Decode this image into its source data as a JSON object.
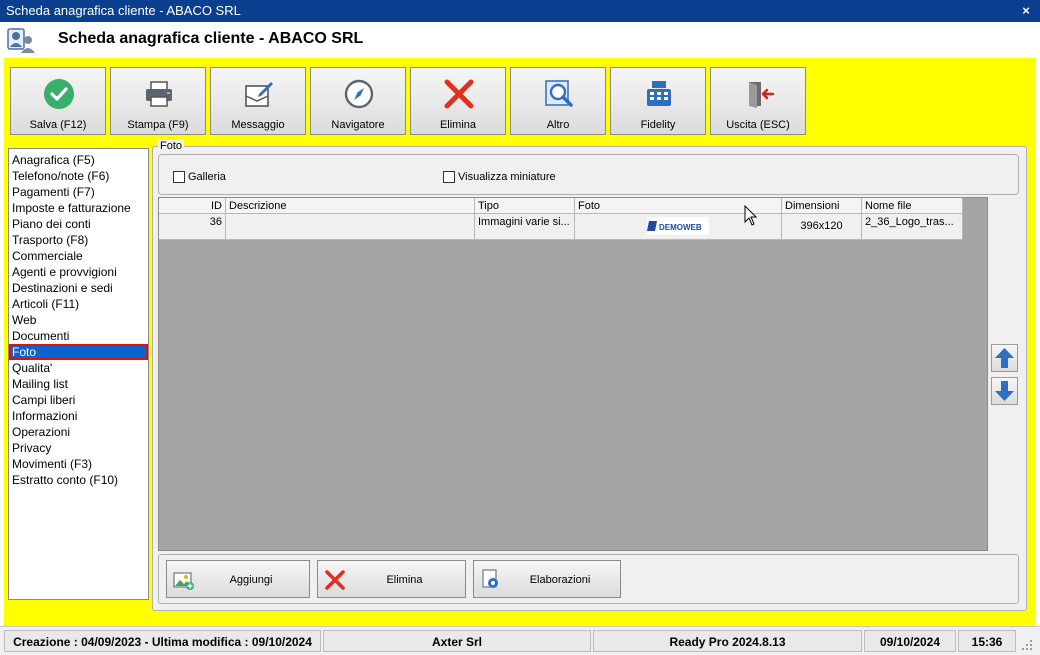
{
  "window": {
    "title": "Scheda anagrafica cliente - ABACO SRL",
    "close_glyph": "×"
  },
  "header": {
    "title": "Scheda anagrafica cliente - ABACO SRL"
  },
  "toolbar": {
    "buttons": [
      {
        "label": "Salva (F12)",
        "icon": "check-circle-icon"
      },
      {
        "label": "Stampa (F9)",
        "icon": "printer-icon"
      },
      {
        "label": "Messaggio",
        "icon": "message-icon"
      },
      {
        "label": "Navigatore",
        "icon": "compass-icon"
      },
      {
        "label": "Elimina",
        "icon": "delete-x-icon"
      },
      {
        "label": "Altro",
        "icon": "magnifier-icon"
      },
      {
        "label": "Fidelity",
        "icon": "cash-register-icon"
      },
      {
        "label": "Uscita (ESC)",
        "icon": "exit-door-icon"
      }
    ]
  },
  "sidebar": {
    "items": [
      "Anagrafica (F5)",
      "Telefono/note (F6)",
      "Pagamenti (F7)",
      "Imposte e fatturazione",
      "Piano dei conti",
      "Trasporto (F8)",
      "Commerciale",
      "Agenti e provvigioni",
      "Destinazioni e sedi",
      "Articoli (F11)",
      "Web",
      "Documenti",
      "Foto",
      "Qualita'",
      "Mailing list",
      "Campi liberi",
      "Informazioni",
      "Operazioni",
      "Privacy",
      "Movimenti (F3)",
      "Estratto conto (F10)"
    ],
    "selected": "Foto"
  },
  "panel": {
    "legend": "Foto",
    "checkbox_galleria": "Galleria",
    "checkbox_miniature": "Visualizza miniature"
  },
  "grid": {
    "columns": [
      "ID",
      "Descrizione",
      "Tipo",
      "Foto",
      "Dimensioni",
      "Nome file"
    ],
    "rows": [
      {
        "id": "36",
        "descrizione": "",
        "tipo": "Immagini varie si...",
        "foto_logo_text": "DEMOWEB",
        "dimensioni": "396x120",
        "nome_file": "2_36_Logo_tras..."
      }
    ]
  },
  "bottom_buttons": [
    {
      "label": "Aggiungi",
      "icon": "add-image-icon"
    },
    {
      "label": "Elimina",
      "icon": "delete-x-icon"
    },
    {
      "label": "Elaborazioni",
      "icon": "gear-document-icon"
    }
  ],
  "status": {
    "dates": "Creazione : 04/09/2023 - Ultima modifica : 09/10/2024",
    "company": "Axter Srl",
    "product": "Ready Pro 2024.8.13",
    "date": "09/10/2024",
    "time": "15:36"
  },
  "colors": {
    "titlebar": "#0a3f8f",
    "workspace": "#ffff00",
    "selection": "#0a64d0",
    "selection_outline": "#e01010"
  }
}
